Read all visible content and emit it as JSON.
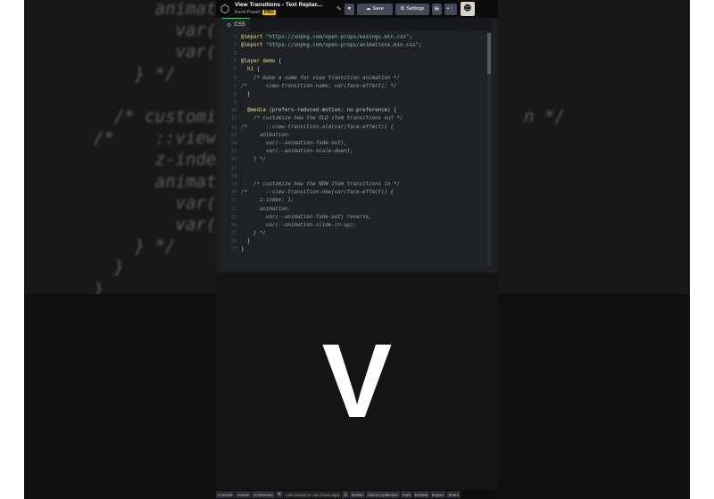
{
  "bg_code": {
    "lines": [
      {
        "num": "",
        "text": "      animation:"
      },
      {
        "num": "",
        "text": "        var(--a"
      },
      {
        "num": "",
        "text": "        var(--a"
      },
      {
        "num": "",
        "text": "    } */"
      },
      {
        "num": "",
        "text": ""
      },
      {
        "num": "",
        "text": "  /* customize"
      },
      {
        "num": "",
        "text": "/*    ::view-t"
      },
      {
        "num": "",
        "text": "      z-index:"
      },
      {
        "num": "",
        "text": "      animation"
      },
      {
        "num": "",
        "text": "        var(--a"
      },
      {
        "num": "",
        "text": "        var(--a"
      },
      {
        "num": "",
        "text": "    } */"
      },
      {
        "num": "",
        "text": "  }"
      },
      {
        "num": "",
        "text": "}"
      }
    ],
    "right_fragment": "n */"
  },
  "topbar": {
    "title": "View Transitions - Text Replac...",
    "author": "Kevin Powell",
    "badge": "PRO",
    "heart_icon": "heart-icon",
    "save_label": "Save",
    "settings_label": "Settings",
    "layout_icon": "layout-icon",
    "more_icon": "more-icon"
  },
  "editor": {
    "tab_label": "CSS",
    "lines": [
      {
        "n": "1",
        "parts": [
          [
            "c-at",
            "@import "
          ],
          [
            "c-str",
            "\"https://unpkg.com/open-props/easings.min.css\""
          ],
          [
            "",
            ";"
          ]
        ]
      },
      {
        "n": "2",
        "parts": [
          [
            "c-at",
            "@import "
          ],
          [
            "c-str",
            "\"https://unpkg.com/open-props/animations.min.css\""
          ],
          [
            "",
            ";"
          ]
        ]
      },
      {
        "n": "3",
        "parts": [
          [
            "",
            ""
          ]
        ]
      },
      {
        "n": "4",
        "parts": [
          [
            "c-at",
            "@layer demo "
          ],
          [
            "",
            "{"
          ]
        ]
      },
      {
        "n": "5",
        "parts": [
          [
            "c-sel",
            "  h1 "
          ],
          [
            "",
            "{"
          ]
        ]
      },
      {
        "n": "6",
        "parts": [
          [
            "c-com",
            "    /* make a name for view transition animation */"
          ]
        ]
      },
      {
        "n": "7",
        "parts": [
          [
            "c-com",
            "/*      view-transition-name: var(face-effect); */"
          ]
        ]
      },
      {
        "n": "8",
        "parts": [
          [
            "",
            "  }"
          ]
        ]
      },
      {
        "n": "9",
        "parts": [
          [
            "",
            ""
          ]
        ]
      },
      {
        "n": "10",
        "parts": [
          [
            "c-at",
            "  @media "
          ],
          [
            "",
            "(prefers-reduced-motion: no-preference) {"
          ]
        ]
      },
      {
        "n": "11",
        "parts": [
          [
            "c-com",
            "    /* customize how the OLD item transitions out */"
          ]
        ]
      },
      {
        "n": "12",
        "parts": [
          [
            "c-com",
            "/*      ::view-transition-old(var(face-effect)) {"
          ]
        ]
      },
      {
        "n": "13",
        "parts": [
          [
            "c-com",
            "      animation:"
          ]
        ]
      },
      {
        "n": "14",
        "parts": [
          [
            "c-com",
            "        var(--animation-fade-out),"
          ]
        ]
      },
      {
        "n": "15",
        "parts": [
          [
            "c-com",
            "        var(--animation-scale-down);"
          ]
        ]
      },
      {
        "n": "16",
        "parts": [
          [
            "c-com",
            "    } */"
          ]
        ]
      },
      {
        "n": "17",
        "parts": [
          [
            "",
            ""
          ]
        ]
      },
      {
        "n": "18",
        "parts": [
          [
            "",
            ""
          ]
        ]
      },
      {
        "n": "19",
        "parts": [
          [
            "c-com",
            "    /* customize how the NEW item transitions in */"
          ]
        ]
      },
      {
        "n": "20",
        "parts": [
          [
            "c-com",
            "/*      ::view-transition-new(var(face-effect)) {"
          ]
        ]
      },
      {
        "n": "21",
        "parts": [
          [
            "c-com",
            "      z-index: 1;"
          ]
        ]
      },
      {
        "n": "22",
        "parts": [
          [
            "c-com",
            "      animation:"
          ]
        ]
      },
      {
        "n": "23",
        "parts": [
          [
            "c-com",
            "        var(--animation-fade-out) reverse,"
          ]
        ]
      },
      {
        "n": "24",
        "parts": [
          [
            "c-com",
            "        var(--animation-slide-in-up);"
          ]
        ]
      },
      {
        "n": "25",
        "parts": [
          [
            "c-com",
            "    } */"
          ]
        ]
      },
      {
        "n": "26",
        "parts": [
          [
            "",
            "  }"
          ]
        ]
      },
      {
        "n": "27",
        "parts": [
          [
            "",
            "}"
          ]
        ]
      }
    ]
  },
  "preview": {
    "glyph": "V"
  },
  "bottombar": {
    "items": [
      "Console",
      "Assets",
      "Comments",
      "⌘",
      "Last saved (or one hours ago)",
      "⏱",
      "Delete",
      "Add to Collection",
      "Fork",
      "Embed",
      "Export",
      "Share"
    ]
  },
  "colors": {
    "accent_green": "#47cf73",
    "badge_yellow": "#f0c000",
    "editor_bg": "#1f2125"
  }
}
